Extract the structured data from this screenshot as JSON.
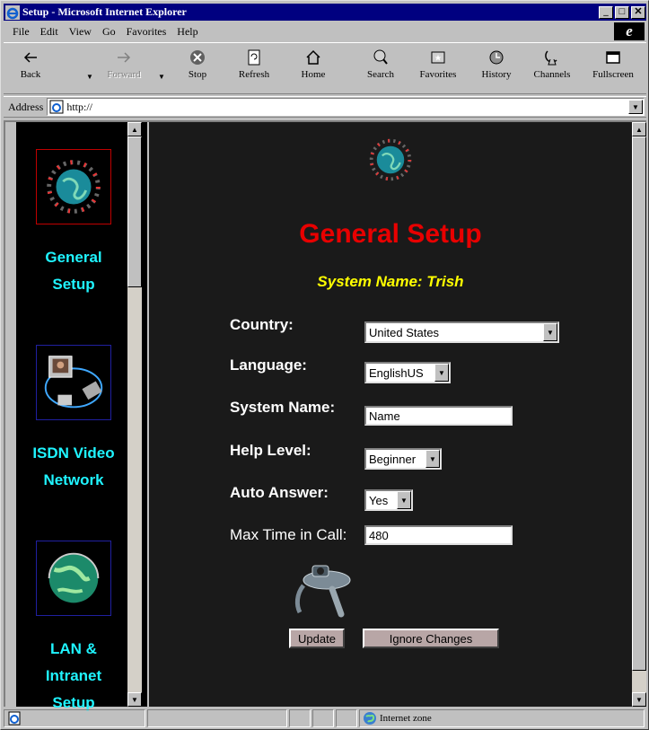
{
  "window": {
    "title": "Setup - Microsoft Internet Explorer"
  },
  "menu": [
    "File",
    "Edit",
    "View",
    "Go",
    "Favorites",
    "Help"
  ],
  "toolbar": {
    "back": "Back",
    "forward": "Forward",
    "stop": "Stop",
    "refresh": "Refresh",
    "home": "Home",
    "search": "Search",
    "favorites": "Favorites",
    "history": "History",
    "channels": "Channels",
    "fullscreen": "Fullscreen"
  },
  "address": {
    "label": "Address",
    "value": "http://"
  },
  "nav": {
    "items": [
      {
        "label_line1": "General",
        "label_line2": "Setup"
      },
      {
        "label_line1": "ISDN Video",
        "label_line2": "Network"
      },
      {
        "label_line1": "LAN &",
        "label_line2": "Intranet",
        "label_line3": "Setup"
      }
    ]
  },
  "main": {
    "title": "General Setup",
    "system_name_heading": "System Name: Trish",
    "fields": {
      "country": {
        "label": "Country:",
        "value": "United States"
      },
      "language": {
        "label": "Language:",
        "value": "EnglishUS"
      },
      "system_name": {
        "label": "System Name:",
        "value": "Name"
      },
      "help_level": {
        "label": "Help Level:",
        "value": "Beginner"
      },
      "auto_answer": {
        "label": "Auto Answer:",
        "value": "Yes"
      },
      "max_time": {
        "label": "Max Time in Call:",
        "value": "480"
      }
    },
    "buttons": {
      "update": "Update",
      "ignore": "Ignore Changes"
    }
  },
  "status": {
    "zone": "Internet zone"
  },
  "colors": {
    "title_bar": "#000080",
    "nav_label": "#1ff4ff",
    "main_title": "#e80000",
    "system_name": "#ffff00",
    "main_bg": "#1a1a1a",
    "button_bg": "#b8a6a6"
  }
}
